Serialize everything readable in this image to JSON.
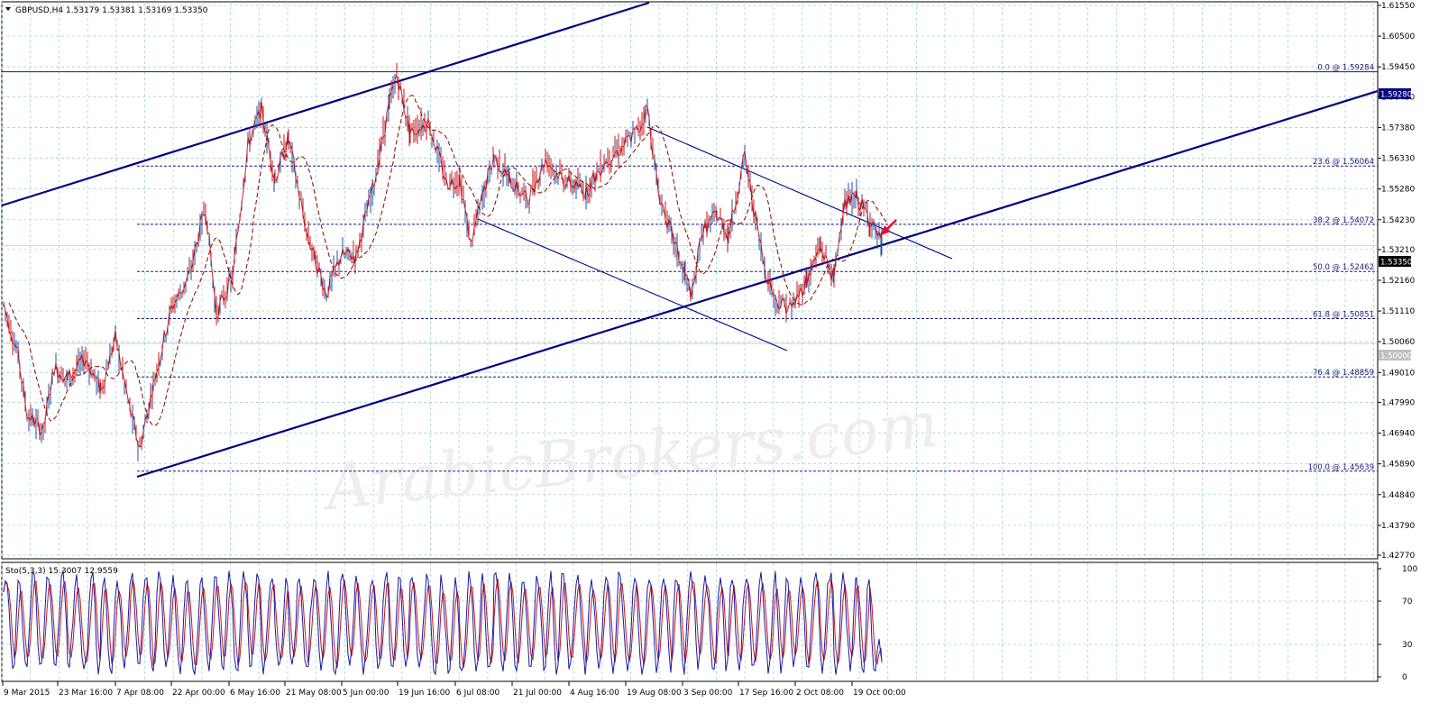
{
  "header": {
    "symbol_line": "GBPUSD,H4  1.53179 1.53381 1.53169 1.53350"
  },
  "stochastic": {
    "label": "Sto(5,3,3) 15.3007 12.9559",
    "levels": [
      "100",
      "70",
      "30",
      "0"
    ]
  },
  "price_axis": {
    "ticks": [
      "1.61550",
      "1.60500",
      "1.59450",
      "1.58430",
      "1.57380",
      "1.56330",
      "1.55280",
      "1.54230",
      "1.53210",
      "1.52160",
      "1.51110",
      "1.50060",
      "1.49010",
      "1.47990",
      "1.46940",
      "1.45890",
      "1.44840",
      "1.43790",
      "1.42770"
    ],
    "current_price_tag": "1.53350",
    "top_tag": "1.59280",
    "mid_tag": "1.50000"
  },
  "time_axis": {
    "labels": [
      "9 Mar 2015",
      "23 Mar 16:00",
      "7 Apr 08:00",
      "22 Apr 00:00",
      "6 May 16:00",
      "21 May 08:00",
      "5 Jun 00:00",
      "19 Jun 16:00",
      "6 Jul 08:00",
      "21 Jul 00:00",
      "4 Aug 16:00",
      "19 Aug 08:00",
      "3 Sep 00:00",
      "17 Sep 16:00",
      "2 Oct 08:00",
      "19 Oct 00:00"
    ]
  },
  "fib_levels": [
    {
      "label": "0.0 @ 1.59284",
      "value": 1.59284
    },
    {
      "label": "23.6 @ 1.56064",
      "value": 1.56064
    },
    {
      "label": "38.2 @ 1.54072",
      "value": 1.54072
    },
    {
      "label": "50.0 @ 1.52462",
      "value": 1.52462
    },
    {
      "label": "61.8 @ 1.50851",
      "value": 1.50851
    },
    {
      "label": "76.4 @ 1.48859",
      "value": 1.48859
    },
    {
      "label": "100.0 @ 1.45639",
      "value": 1.45639
    }
  ],
  "watermark": "ArabicBrokers.com",
  "colors": {
    "candle": "#c4161c",
    "candle_alt": "#1f4fa0",
    "trendline": "#000080",
    "fib": "#1a1a7a",
    "grid": "#9fd4d8",
    "ma": "#8b0000",
    "stoch_main": "#1a1aa0",
    "stoch_signal": "#c4161c",
    "arrow": "#e0102a"
  },
  "chart_data": {
    "type": "line",
    "title": "GBPUSD,H4",
    "ohlc_last": {
      "open": 1.53179,
      "high": 1.53381,
      "low": 1.53169,
      "close": 1.5335
    },
    "x": [
      "9 Mar 2015",
      "23 Mar 16:00",
      "7 Apr 08:00",
      "22 Apr 00:00",
      "6 May 16:00",
      "21 May 08:00",
      "5 Jun 00:00",
      "19 Jun 16:00",
      "6 Jul 08:00",
      "21 Jul 00:00",
      "4 Aug 16:00",
      "19 Aug 08:00",
      "3 Sep 00:00",
      "17 Sep 16:00",
      "2 Oct 08:00",
      "19 Oct 00:00"
    ],
    "series": [
      {
        "values": [
          1.512,
          1.486,
          1.462,
          1.525,
          1.579,
          1.531,
          1.591,
          1.566,
          1.54,
          1.558,
          1.557,
          1.578,
          1.52,
          1.515,
          1.54,
          1.5335
        ]
      }
    ],
    "ylim": [
      1.4277,
      1.6155
    ],
    "stochastic_series": [
      {
        "values": [
          85,
          15,
          50,
          90,
          30,
          80,
          95,
          20,
          70,
          85,
          10,
          90,
          20,
          85,
          95,
          13
        ]
      }
    ],
    "stochastic_ylim": [
      0,
      100
    ]
  }
}
